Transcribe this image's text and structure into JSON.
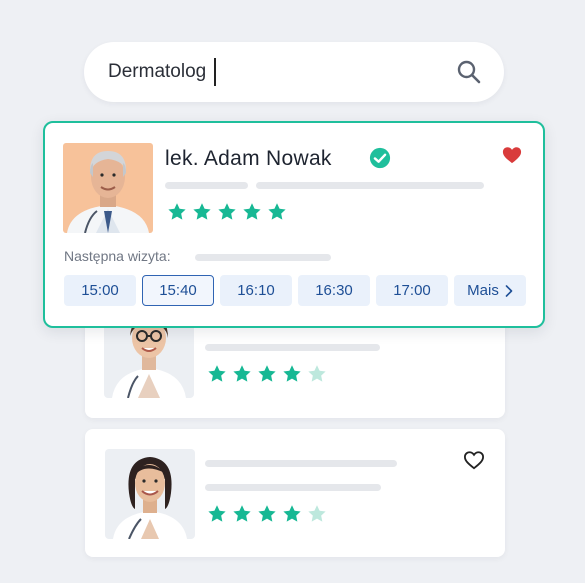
{
  "search": {
    "query": "Dermatolog"
  },
  "main_doctor": {
    "name": "lek. Adam Nowak",
    "rating": 5,
    "favorited": true,
    "next_visit_label": "Następna wizyta:",
    "time_slots": [
      "15:00",
      "15:40",
      "16:10",
      "16:30",
      "17:00"
    ],
    "selected_slot": "15:40",
    "more_label": "Mais"
  },
  "doctor_cards": [
    {
      "rating": 4,
      "favorited": false
    },
    {
      "rating": 4,
      "favorited": false
    }
  ],
  "colors": {
    "accent": "#1fbf9c",
    "star_filled": "#17b894",
    "star_empty": "#bde8dd",
    "heart": "#d93b3b",
    "slot_text": "#1e4f96"
  },
  "icons": {
    "search": "search-icon",
    "verified": "verified-check-icon",
    "favorite_filled": "heart-filled-icon",
    "favorite_outline": "heart-outline-icon",
    "star": "star-icon",
    "more": "chevron-right-icon"
  }
}
